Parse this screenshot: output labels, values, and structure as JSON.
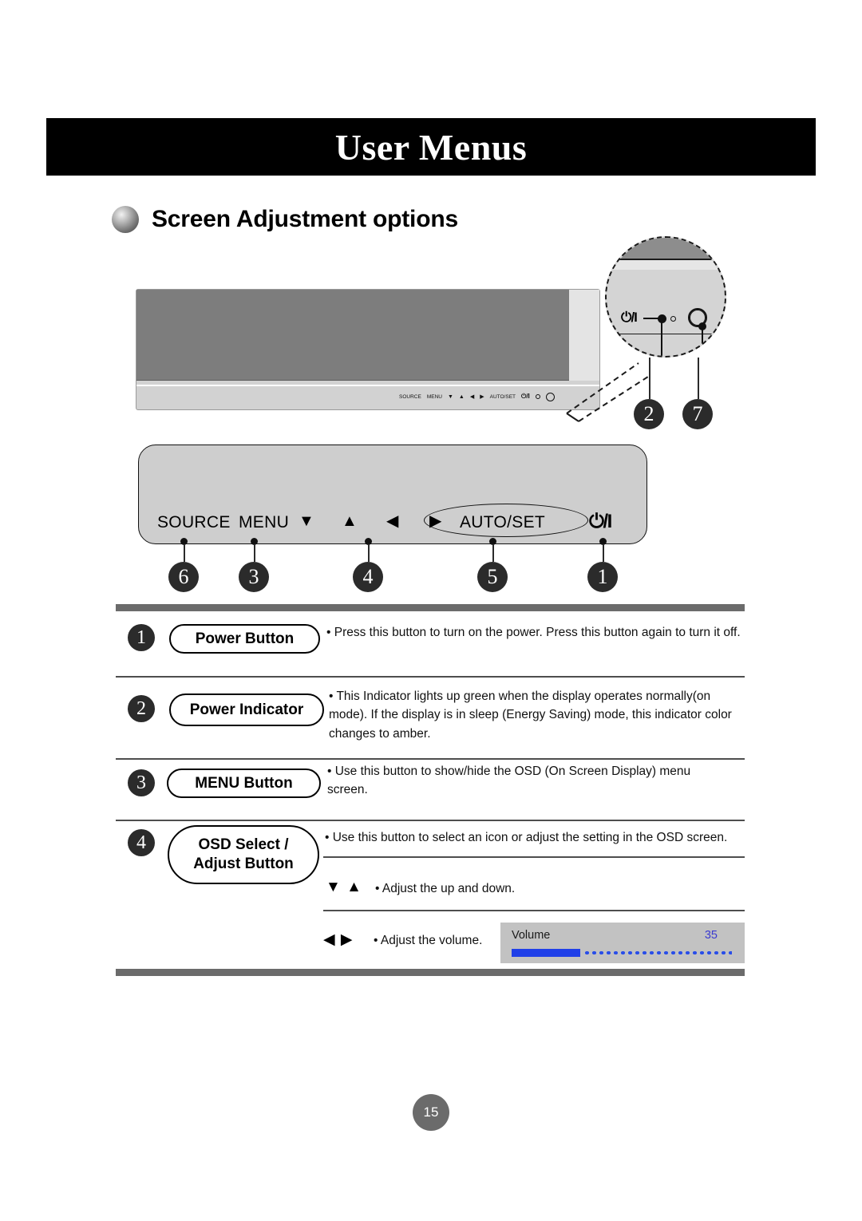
{
  "header": {
    "title": "User Menus"
  },
  "section": {
    "bullet_icon": "sphere-bullet-icon",
    "title": "Screen Adjustment options"
  },
  "monitor_diagram": {
    "button_row": [
      "SOURCE",
      "MENU",
      "▼",
      "▲",
      "◀",
      "▶",
      "AUTO/SET",
      "⏻/I"
    ],
    "power_symbol": "⏻/I",
    "indicator_icon": "power-indicator-icon",
    "sensor_icon": "remote-sensor-icon",
    "callouts": [
      {
        "number": "2",
        "target": "power-indicator"
      },
      {
        "number": "7",
        "target": "remote-sensor"
      }
    ]
  },
  "control_panel": {
    "labels": [
      {
        "text": "SOURCE",
        "callout": "6"
      },
      {
        "text": "MENU",
        "callout": "3"
      },
      {
        "text": "AUTO/SET",
        "callout": "5"
      },
      {
        "text": "⏻/I",
        "callout": "1"
      }
    ],
    "arrows": {
      "down": "▼",
      "up": "▲",
      "left": "◀",
      "right": "▶",
      "callout": "4"
    },
    "callout_numbers": [
      "6",
      "3",
      "4",
      "5",
      "1"
    ]
  },
  "table": {
    "rows": [
      {
        "number": "1",
        "label": "Power Button",
        "description": "• Press this button to turn on the power. Press this button again to turn it off."
      },
      {
        "number": "2",
        "label": "Power Indicator",
        "description": "• This Indicator lights up green when the display operates normally(on mode). If the display is in sleep (Energy Saving) mode, this indicator color changes to amber."
      },
      {
        "number": "3",
        "label": "MENU Button",
        "description": "• Use this button to show/hide the OSD (On Screen Display) menu screen."
      },
      {
        "number": "4",
        "label_line1": "OSD Select /",
        "label_line2": "Adjust Button",
        "description": "•  Use this button to select an icon or adjust the setting in the OSD screen.",
        "sub_rows": [
          {
            "arrows": "▼ ▲",
            "description": "• Adjust the up and down."
          },
          {
            "arrows": "◀ ▶",
            "description": "• Adjust the volume."
          }
        ]
      }
    ]
  },
  "volume_osd": {
    "label": "Volume",
    "value": "35",
    "fill_percent": 31,
    "accent_color": "#1f3fe8",
    "value_color": "#3a3ad0",
    "background_color": "#c2c2c2"
  },
  "footer": {
    "page_number": "15"
  }
}
